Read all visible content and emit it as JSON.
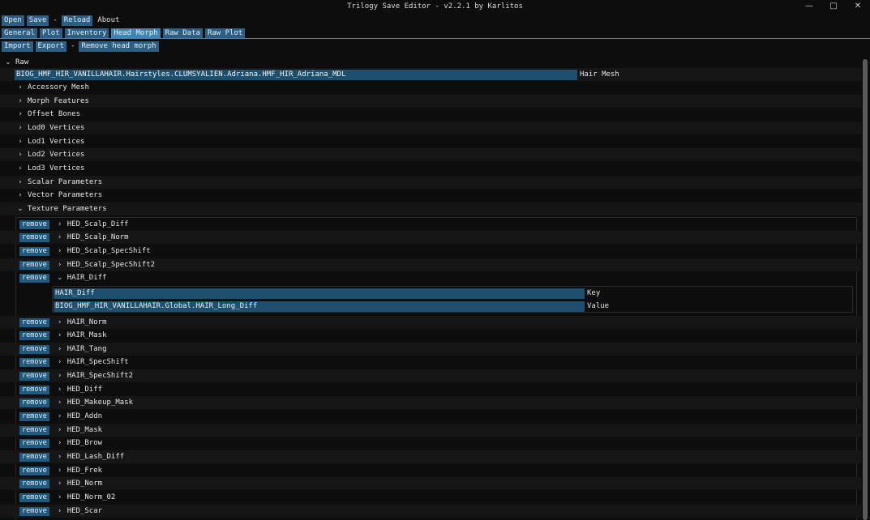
{
  "window": {
    "title": "Trilogy Save Editor - v2.2.1 by Karlitos"
  },
  "menu": {
    "open": "Open",
    "save": "Save",
    "sep": "-",
    "reload": "Reload",
    "about": "About"
  },
  "tabs": [
    "General",
    "Plot",
    "Inventory",
    "Head Morph",
    "Raw Data",
    "Raw Plot"
  ],
  "actions": {
    "import": "Import",
    "export": "Export",
    "sep": "-",
    "remove_head_morph": "Remove head morph"
  },
  "tree": {
    "root": "Raw",
    "hair_mesh_value": "BIOG_HMF_HIR_VANILLAHAIR.Hairstyles.CLUMSYALIEN.Adriana.HMF_HIR_Adriana_MDL",
    "hair_mesh_label": "Hair Mesh",
    "sections": [
      "Accessory Mesh",
      "Morph Features",
      "Offset Bones",
      "Lod0 Vertices",
      "Lod1 Vertices",
      "Lod2 Vertices",
      "Lod3 Vertices",
      "Scalar Parameters",
      "Vector Parameters"
    ],
    "texture_section": "Texture Parameters",
    "remove_label": "remove",
    "textures_before": [
      "HED_Scalp_Diff",
      "HED_Scalp_Norm",
      "HED_Scalp_SpecShift",
      "HED_Scalp_SpecShift2"
    ],
    "expanded": {
      "name": "HAIR_Diff",
      "key_value": "HAIR_Diff",
      "key_label": "Key",
      "value_value": "BIOG_HMF_HIR_VANILLAHAIR.Global.HAIR_Long_Diff",
      "value_label": "Value"
    },
    "textures_after": [
      "HAIR_Norm",
      "HAIR_Mask",
      "HAIR_Tang",
      "HAIR_SpecShift",
      "HAIR_SpecShift2",
      "HED_Diff",
      "HED_Makeup_Mask",
      "HED_Addn",
      "HED_Mask",
      "HED_Brow",
      "HED_Lash_Diff",
      "HED_Frek",
      "HED_Norm",
      "HED_Norm_02",
      "HED_Scar"
    ]
  }
}
